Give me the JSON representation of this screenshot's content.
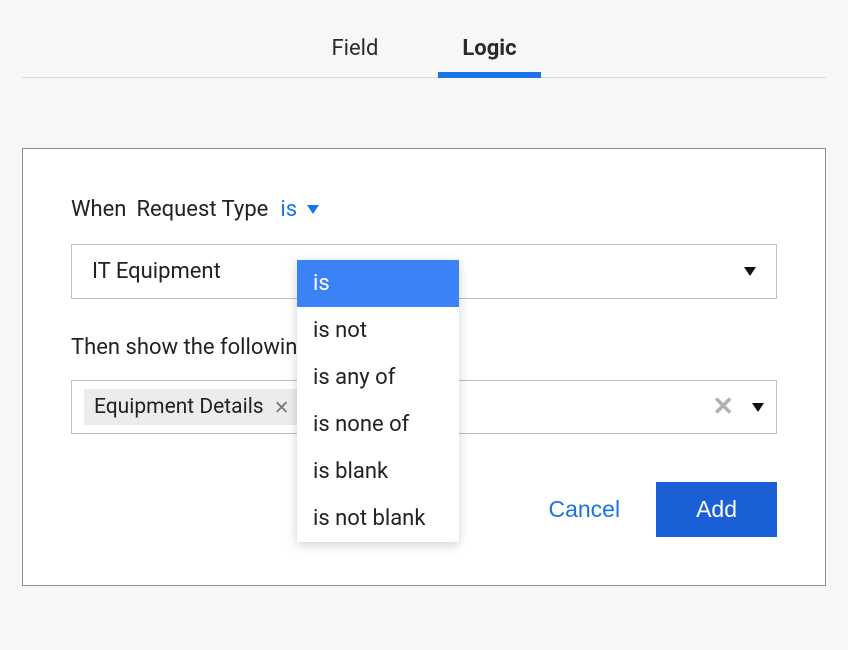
{
  "tabs": {
    "field": "Field",
    "logic": "Logic",
    "active": "logic"
  },
  "condition": {
    "when_prefix": "When",
    "field_name": "Request Type",
    "operator_selected": "is",
    "value_selected": "IT Equipment",
    "operator_options": [
      "is",
      "is not",
      "is any of",
      "is none of",
      "is blank",
      "is not blank"
    ]
  },
  "action": {
    "then_label": "Then show the following fields",
    "selected_fields": [
      "Equipment Details"
    ]
  },
  "buttons": {
    "cancel": "Cancel",
    "add": "Add"
  },
  "colors": {
    "accent": "#1a73e8",
    "primary_button": "#1a5fd6",
    "chip_bg": "#ececec",
    "dropdown_selected": "#3b82f6"
  }
}
